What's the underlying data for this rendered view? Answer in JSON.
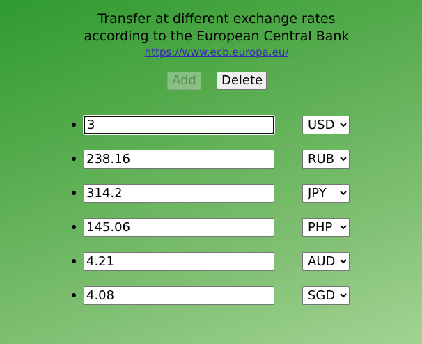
{
  "header": {
    "title_line1": "Transfer at different exchange rates",
    "title_line2": "according to the European Central Bank",
    "link_text": "https://www.ecb.europa.eu/"
  },
  "toolbar": {
    "add_label": "Add",
    "add_disabled": true,
    "delete_label": "Delete"
  },
  "rows": [
    {
      "amount": "3",
      "currency": "USD",
      "focused": true
    },
    {
      "amount": "238.16",
      "currency": "RUB"
    },
    {
      "amount": "314.2",
      "currency": "JPY"
    },
    {
      "amount": "145.06",
      "currency": "PHP"
    },
    {
      "amount": "4.21",
      "currency": "AUD"
    },
    {
      "amount": "4.08",
      "currency": "SGD"
    }
  ]
}
